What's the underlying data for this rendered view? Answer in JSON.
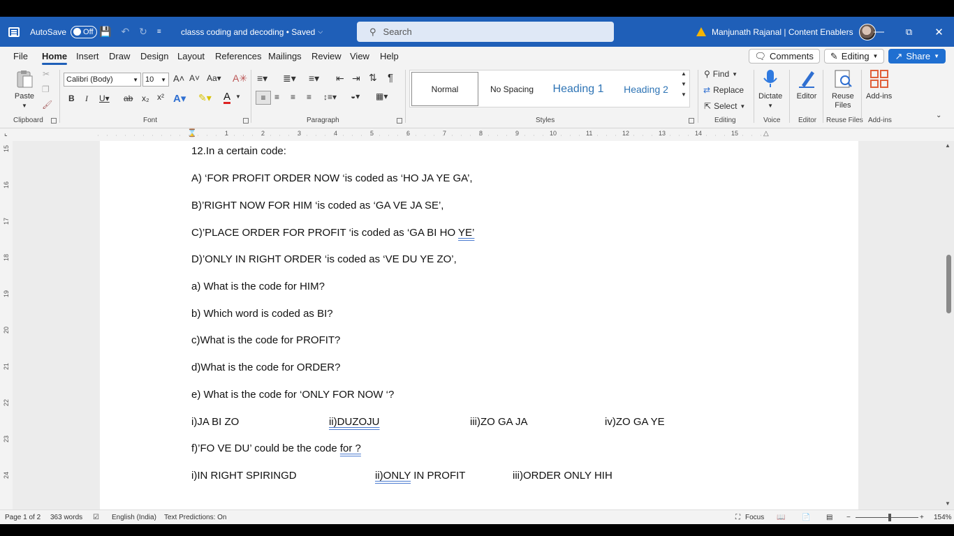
{
  "titlebar": {
    "autosave_label": "AutoSave",
    "autosave_state": "Off",
    "doc_title": "classs coding and decoding • Saved",
    "search_placeholder": "Search",
    "user": "Manjunath Rajanal | Content Enablers"
  },
  "ribbon": {
    "tabs": [
      "File",
      "Home",
      "Insert",
      "Draw",
      "Design",
      "Layout",
      "References",
      "Mailings",
      "Review",
      "View",
      "Help"
    ],
    "active_tab": "Home",
    "comments": "Comments",
    "editing": "Editing",
    "share": "Share",
    "clipboard": {
      "paste": "Paste",
      "label": "Clipboard"
    },
    "font": {
      "family": "Calibri (Body)",
      "size": "10",
      "label": "Font"
    },
    "paragraph_label": "Paragraph",
    "styles": {
      "items": [
        "Normal",
        "No Spacing",
        "Heading 1",
        "Heading 2"
      ],
      "label": "Styles"
    },
    "editing_group": {
      "find": "Find",
      "replace": "Replace",
      "select": "Select",
      "label": "Editing"
    },
    "voice": {
      "dictate": "Dictate",
      "label": "Voice"
    },
    "editor": {
      "editor": "Editor",
      "label": "Editor"
    },
    "reuse": {
      "line1": "Reuse",
      "line2": "Files",
      "label": "Reuse Files"
    },
    "addins": {
      "addins": "Add-ins",
      "label": "Add-ins"
    }
  },
  "ruler": {
    "numbers": [
      "1",
      "2",
      "3",
      "4",
      "5",
      "6",
      "7",
      "8",
      "9",
      "10",
      "11",
      "12",
      "13",
      "14",
      "15"
    ],
    "vnumbers": [
      "15",
      "16",
      "17",
      "18",
      "19",
      "20",
      "21",
      "22",
      "23",
      "24"
    ]
  },
  "document": {
    "lines": [
      "12.In a certain code:",
      "A) ‘FOR PROFIT ORDER NOW ‘is coded as ‘HO JA YE GA’,",
      "B)’RIGHT NOW FOR HIM ‘is coded as ‘GA VE JA SE’,",
      "C)’PLACE ORDER FOR PROFIT ‘is coded as ‘GA BI HO ",
      "D)’ONLY IN RIGHT ORDER ‘is coded as ‘VE DU YE ZO’,",
      "a) What is the code for HIM?",
      "b) Which word is coded as BI?",
      "c)What is the code for PROFIT?",
      "d)What is the code for ORDER?",
      "e) What is the code for ‘ONLY FOR NOW ‘?"
    ],
    "line_c_tail": "YE’",
    "options_e": [
      "i)JA BI ZO",
      "ii)DUZOJU",
      "iii)ZO GA JA",
      "iv)ZO GA YE"
    ],
    "line_f_head": "f)’FO VE DU’ could be the code ",
    "line_f_tail": "for ?",
    "options_f": [
      "i)IN RIGHT SPIRINGD",
      "ii)ONLY",
      " IN PROFIT",
      "iii)ORDER ONLY HIH"
    ]
  },
  "statusbar": {
    "page": "Page 1 of 2",
    "words": "363 words",
    "language": "English (India)",
    "predictions": "Text Predictions: On",
    "focus": "Focus",
    "zoom": "154%"
  }
}
